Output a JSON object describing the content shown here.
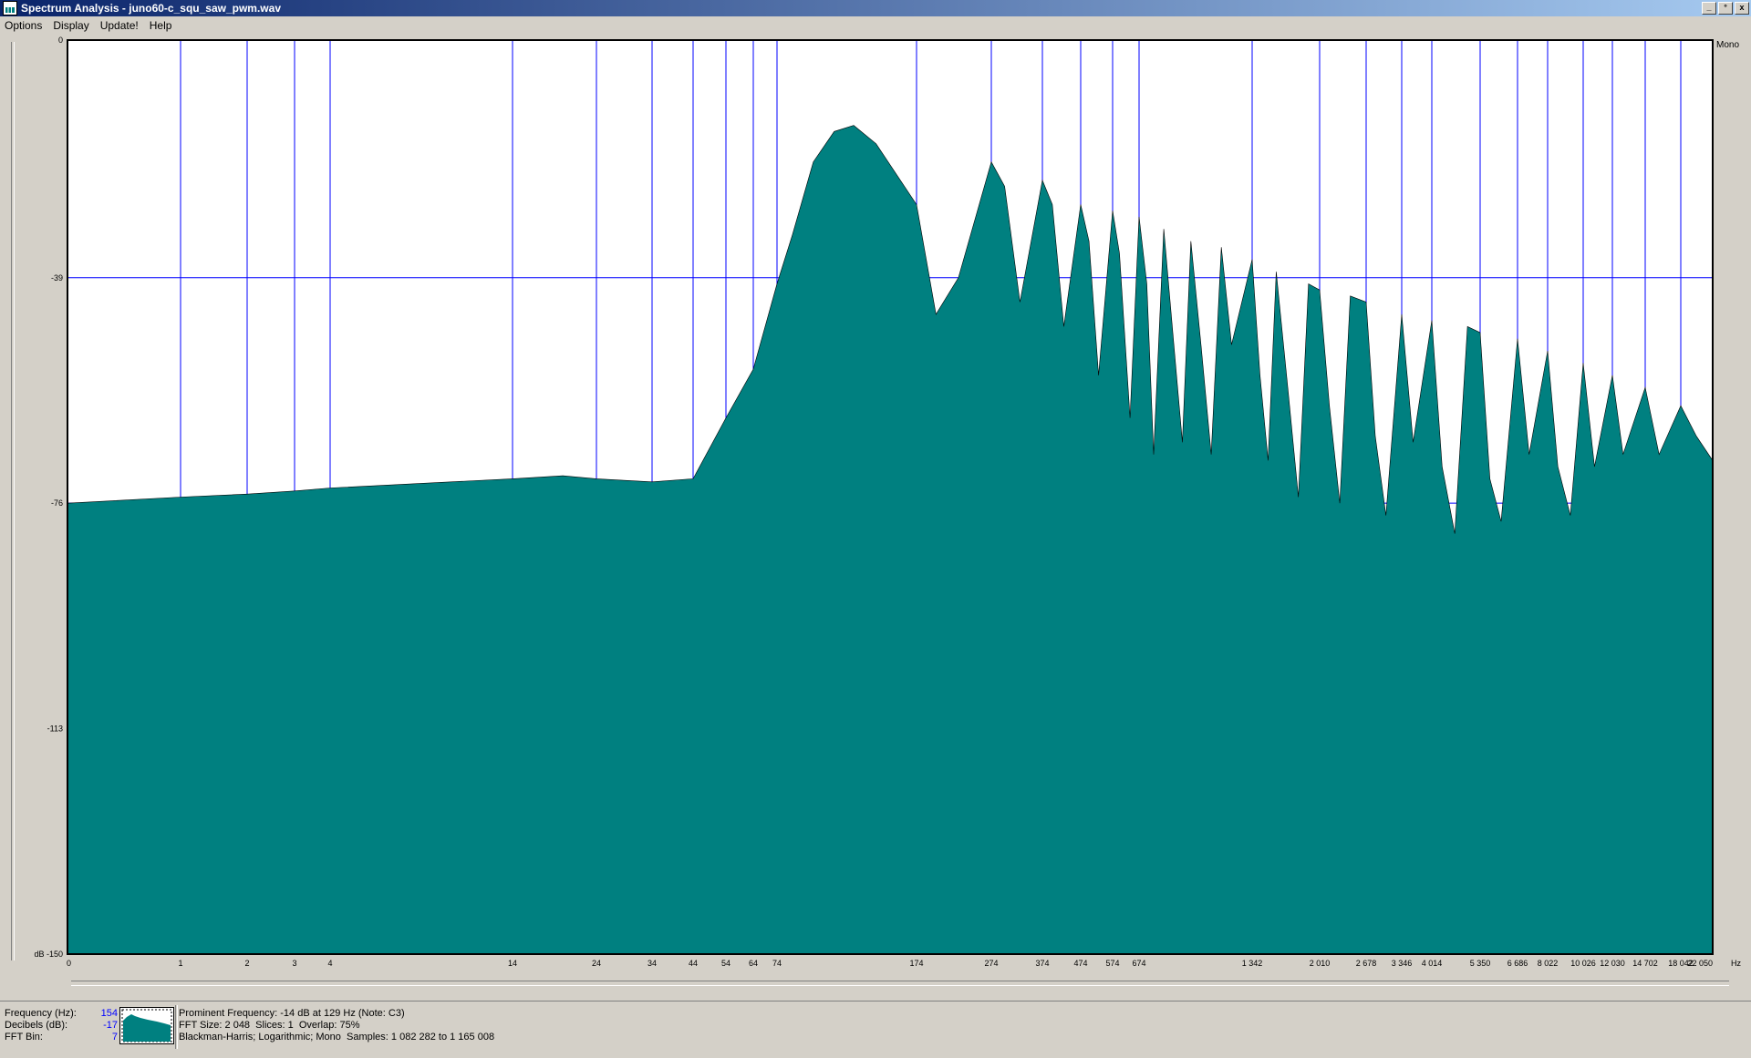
{
  "window": {
    "title": "Spectrum Analysis - juno60-c_squ_saw_pwm.wav",
    "controls": [
      "_",
      "°",
      "x"
    ]
  },
  "menu": [
    "Options",
    "Display",
    "Update!",
    "Help"
  ],
  "chart_data": {
    "type": "area",
    "channel_label": "Mono",
    "xlabel": "Hz",
    "ylabel": "dB",
    "ylim": [
      -150,
      0
    ],
    "x_scale": "log",
    "fill_color": "#008080",
    "grid_color": "#0000ff",
    "grid": true,
    "y_ticks": [
      {
        "value": 0,
        "label": "0"
      },
      {
        "value": -39,
        "label": "-39"
      },
      {
        "value": -76,
        "label": "-76"
      },
      {
        "value": -113,
        "label": "-113"
      },
      {
        "value": -150,
        "label": "dB -150"
      }
    ],
    "x_ticks": [
      {
        "value": 0,
        "label": "0"
      },
      {
        "value": 1,
        "label": "1"
      },
      {
        "value": 2,
        "label": "2"
      },
      {
        "value": 3,
        "label": "3"
      },
      {
        "value": 4,
        "label": "4"
      },
      {
        "value": 14,
        "label": "14"
      },
      {
        "value": 24,
        "label": "24"
      },
      {
        "value": 34,
        "label": "34"
      },
      {
        "value": 44,
        "label": "44"
      },
      {
        "value": 54,
        "label": "54"
      },
      {
        "value": 64,
        "label": "64"
      },
      {
        "value": 74,
        "label": "74"
      },
      {
        "value": 174,
        "label": "174"
      },
      {
        "value": 274,
        "label": "274"
      },
      {
        "value": 374,
        "label": "374"
      },
      {
        "value": 474,
        "label": "474"
      },
      {
        "value": 574,
        "label": "574"
      },
      {
        "value": 674,
        "label": "674"
      },
      {
        "value": 1342,
        "label": "1 342"
      },
      {
        "value": 2010,
        "label": "2 010"
      },
      {
        "value": 2678,
        "label": "2 678"
      },
      {
        "value": 3346,
        "label": "3 346"
      },
      {
        "value": 4014,
        "label": "4 014"
      },
      {
        "value": 5350,
        "label": "5 350"
      },
      {
        "value": 6686,
        "label": "6 686"
      },
      {
        "value": 8022,
        "label": "8 022"
      },
      {
        "value": 10026,
        "label": "10 026"
      },
      {
        "value": 12030,
        "label": "12 030"
      },
      {
        "value": 14702,
        "label": "14 702"
      },
      {
        "value": 18042,
        "label": "18 042"
      },
      {
        "value": 22050,
        "label": "22 050"
      }
    ],
    "series": [
      {
        "values": [
          [
            0,
            -76
          ],
          [
            1,
            -75
          ],
          [
            2,
            -74.5
          ],
          [
            3,
            -74
          ],
          [
            4,
            -73.5
          ],
          [
            14,
            -72
          ],
          [
            20,
            -71.5
          ],
          [
            24,
            -72
          ],
          [
            34,
            -72.5
          ],
          [
            44,
            -72
          ],
          [
            54,
            -62
          ],
          [
            64,
            -54
          ],
          [
            74,
            -40
          ],
          [
            85,
            -32
          ],
          [
            100,
            -20
          ],
          [
            115,
            -15
          ],
          [
            129,
            -14
          ],
          [
            145,
            -17
          ],
          [
            174,
            -27
          ],
          [
            200,
            -45
          ],
          [
            230,
            -39
          ],
          [
            274,
            -20
          ],
          [
            300,
            -24
          ],
          [
            330,
            -43
          ],
          [
            374,
            -23
          ],
          [
            400,
            -27
          ],
          [
            430,
            -47
          ],
          [
            474,
            -27
          ],
          [
            500,
            -33
          ],
          [
            530,
            -55
          ],
          [
            574,
            -28
          ],
          [
            600,
            -35
          ],
          [
            640,
            -62
          ],
          [
            674,
            -29
          ],
          [
            720,
            -40
          ],
          [
            760,
            -68
          ],
          [
            820,
            -31
          ],
          [
            870,
            -47
          ],
          [
            930,
            -66
          ],
          [
            980,
            -33
          ],
          [
            1040,
            -50
          ],
          [
            1100,
            -68
          ],
          [
            1160,
            -34
          ],
          [
            1220,
            -50
          ],
          [
            1342,
            -36
          ],
          [
            1420,
            -55
          ],
          [
            1500,
            -69
          ],
          [
            1580,
            -38
          ],
          [
            1700,
            -58
          ],
          [
            1800,
            -75
          ],
          [
            1900,
            -40
          ],
          [
            2010,
            -41
          ],
          [
            2150,
            -60
          ],
          [
            2300,
            -76
          ],
          [
            2450,
            -42
          ],
          [
            2678,
            -43
          ],
          [
            2850,
            -65
          ],
          [
            3050,
            -78
          ],
          [
            3346,
            -45
          ],
          [
            3600,
            -66
          ],
          [
            4014,
            -46
          ],
          [
            4300,
            -70
          ],
          [
            4650,
            -81
          ],
          [
            5000,
            -47
          ],
          [
            5350,
            -48
          ],
          [
            5700,
            -72
          ],
          [
            6100,
            -79
          ],
          [
            6686,
            -49
          ],
          [
            7200,
            -68
          ],
          [
            8022,
            -51
          ],
          [
            8600,
            -70
          ],
          [
            9300,
            -78
          ],
          [
            10026,
            -53
          ],
          [
            10800,
            -70
          ],
          [
            12030,
            -55
          ],
          [
            12900,
            -68
          ],
          [
            14702,
            -57
          ],
          [
            16000,
            -68
          ],
          [
            18042,
            -60
          ],
          [
            20000,
            -65
          ],
          [
            22050,
            -69
          ]
        ]
      }
    ]
  },
  "status": {
    "readout": [
      {
        "label": "Frequency (Hz):",
        "value": "154"
      },
      {
        "label": "Decibels (dB):",
        "value": "-17"
      },
      {
        "label": "FFT Bin:",
        "value": "7"
      }
    ],
    "info": [
      "Prominent Frequency: -14 dB at 129 Hz (Note: C3)",
      "FFT Size: 2 048  Slices: 1  Overlap: 75%",
      "Blackman-Harris; Logarithmic; Mono  Samples: 1 082 282 to 1 165 008"
    ]
  }
}
